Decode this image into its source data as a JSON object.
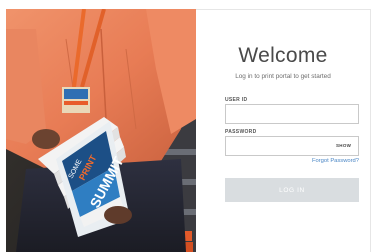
{
  "photo": {
    "booklet_small_text": "SOME",
    "booklet_red_text": "PRINT",
    "booklet_main_text": "SUMMIT"
  },
  "login": {
    "title": "Welcome",
    "subtitle": "Log in to print portal to get started",
    "user_id_label": "USER ID",
    "user_id_value": "",
    "password_label": "PASSWORD",
    "password_value": "",
    "show_label": "SHOW",
    "forgot_label": "Forgot Password?",
    "login_button_label": "LOG IN"
  }
}
